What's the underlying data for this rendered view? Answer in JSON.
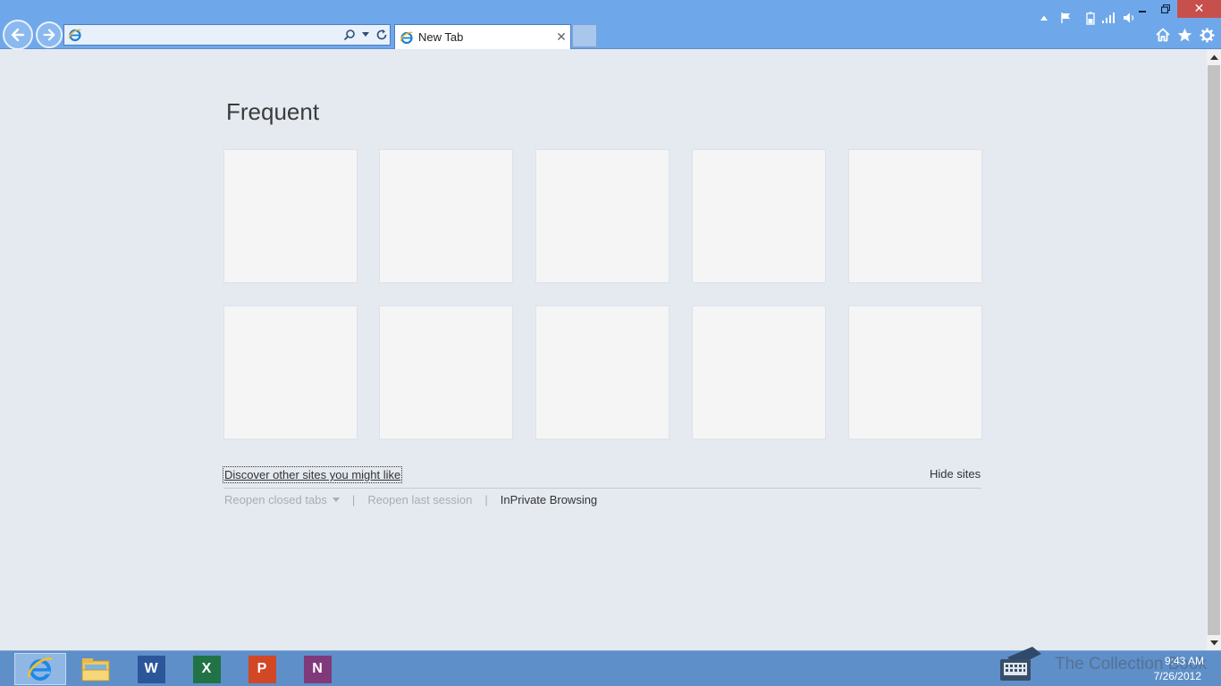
{
  "window": {
    "minimize_symbol": "–",
    "restore_symbol": "❐",
    "close_symbol": "✕"
  },
  "toolbar": {
    "address_value": "",
    "address_placeholder": "",
    "search_icon": "search-icon",
    "dropdown_icon": "chevron-down-icon",
    "refresh_icon": "refresh-icon",
    "home_icon": "home-icon",
    "favorites_icon": "star-icon",
    "settings_icon": "gear-icon"
  },
  "tabs": [
    {
      "label": "New Tab",
      "close_symbol": "✕"
    }
  ],
  "page": {
    "title": "Frequent",
    "tile_count": 10,
    "discover_link": "Discover other sites you might like",
    "hide_sites": "Hide sites",
    "footer": {
      "reopen_closed_tabs": "Reopen closed tabs",
      "separator": "|",
      "reopen_last_session": "Reopen last session",
      "inprivate": "InPrivate Browsing"
    }
  },
  "taskbar": {
    "apps": [
      {
        "name": "Internet Explorer",
        "icon": "ie-icon",
        "active": true
      },
      {
        "name": "File Explorer",
        "icon": "folder-icon",
        "active": false
      },
      {
        "name": "Word",
        "icon": "word-icon",
        "letter": "W",
        "color": "#2b579a"
      },
      {
        "name": "Excel",
        "icon": "excel-icon",
        "letter": "X",
        "color": "#217346"
      },
      {
        "name": "PowerPoint",
        "icon": "powerpoint-icon",
        "letter": "P",
        "color": "#d24726"
      },
      {
        "name": "OneNote",
        "icon": "onenote-icon",
        "letter": "N",
        "color": "#80397b"
      }
    ],
    "clock_time": "9:43 AM",
    "clock_date": "7/26/2012",
    "watermark": "The Collection Book"
  },
  "colors": {
    "chrome": "#6fa8ea",
    "page_bg": "#e5eaf1",
    "tile_bg": "#f5f5f5",
    "taskbar": "#5e8fc9",
    "close_red": "#c7504c"
  }
}
